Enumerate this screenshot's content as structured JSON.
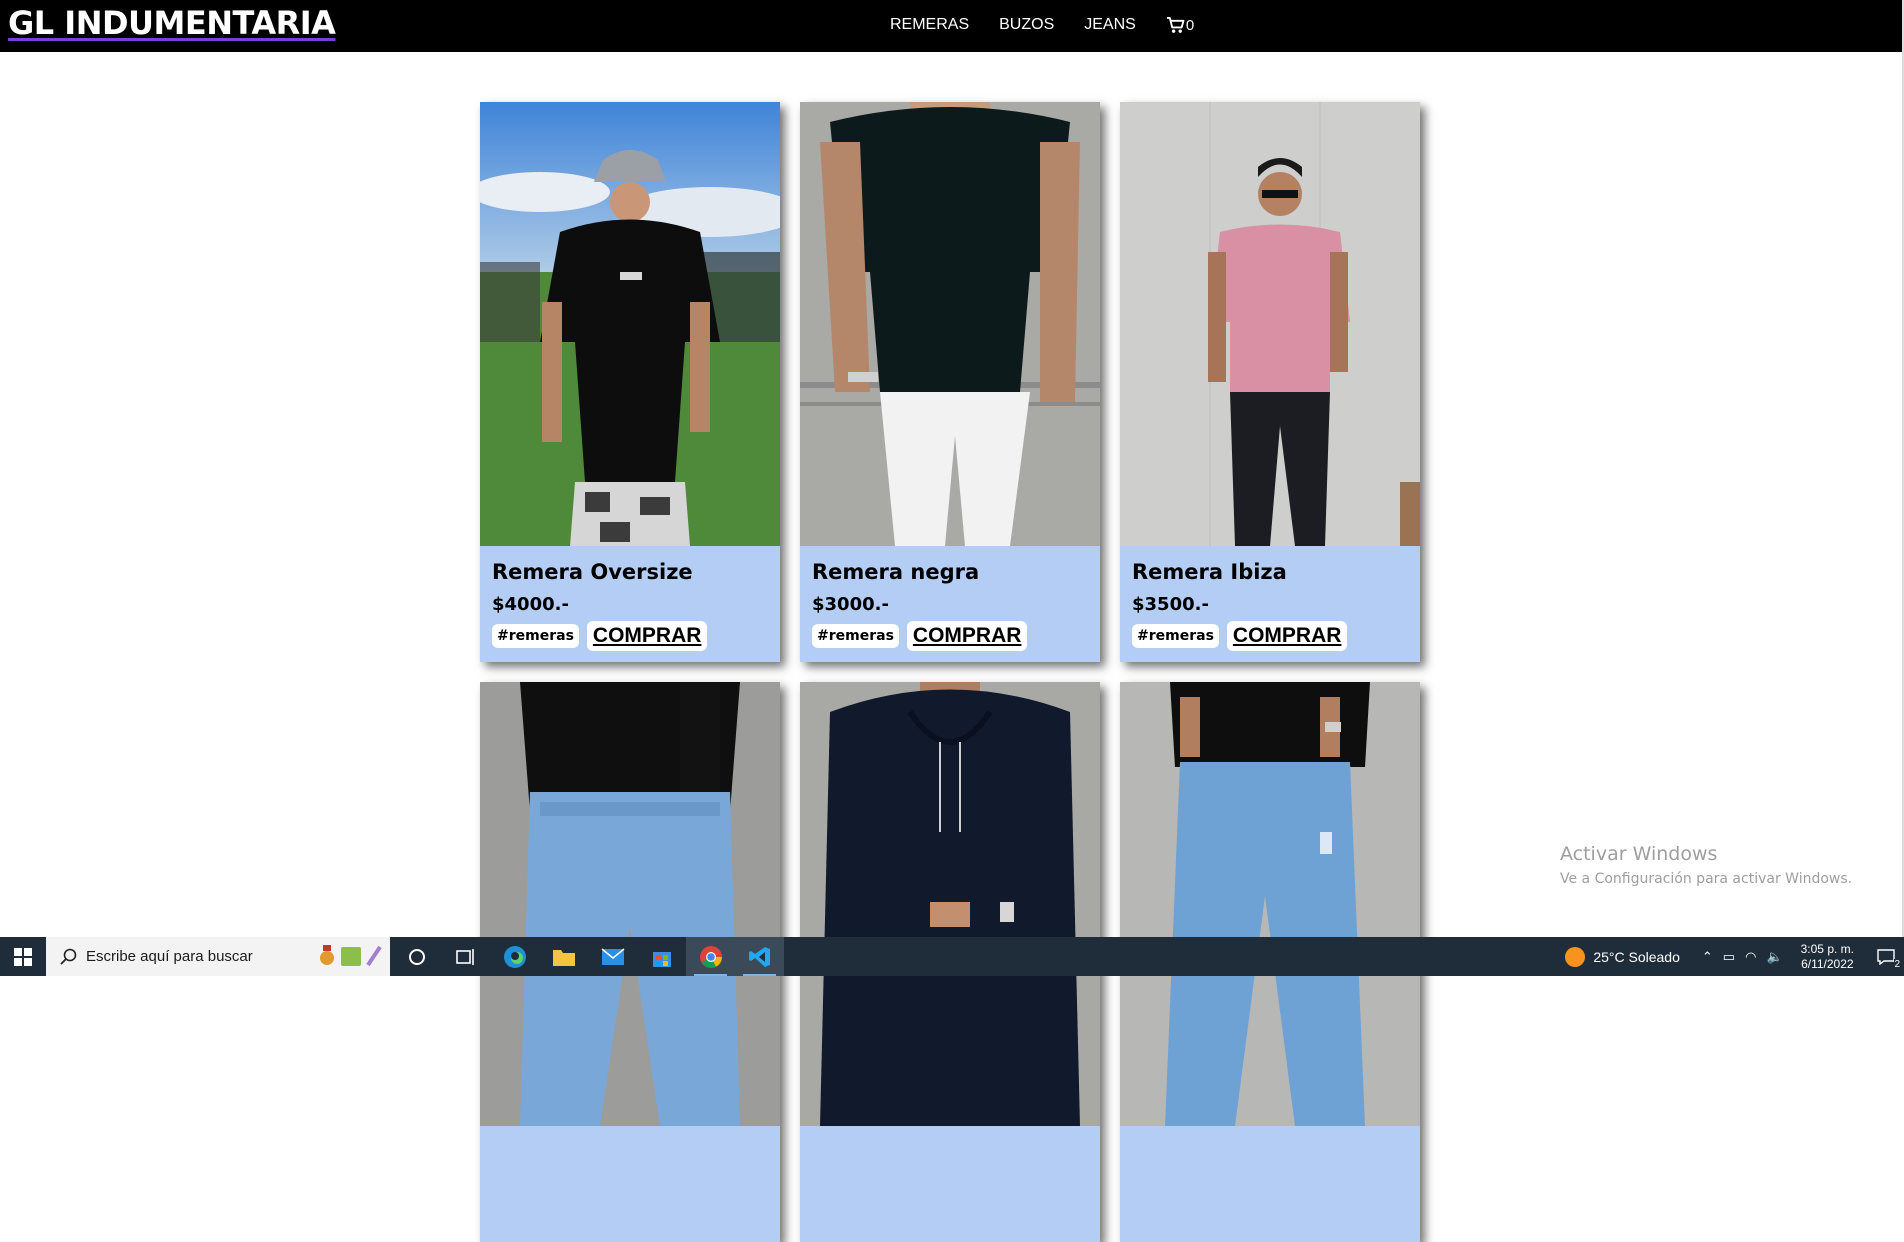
{
  "brand": "GL INDUMENTARIA",
  "nav": {
    "links": [
      "REMERAS",
      "BUZOS",
      "JEANS"
    ],
    "cart_count": "0"
  },
  "products": [
    {
      "title": "Remera Oversize",
      "price": "$4000.-",
      "tag": "#remeras",
      "buy_label": "COMPRAR"
    },
    {
      "title": "Remera negra",
      "price": "$3000.-",
      "tag": "#remeras",
      "buy_label": "COMPRAR"
    },
    {
      "title": "Remera Ibiza",
      "price": "$3500.-",
      "tag": "#remeras",
      "buy_label": "COMPRAR"
    },
    {
      "title": "",
      "price": "",
      "tag": "",
      "buy_label": ""
    },
    {
      "title": "",
      "price": "",
      "tag": "",
      "buy_label": ""
    },
    {
      "title": "",
      "price": "",
      "tag": "",
      "buy_label": ""
    }
  ],
  "watermark": {
    "line1": "Activar Windows",
    "line2": "Ve a Configuración para activar Windows."
  },
  "taskbar": {
    "search_placeholder": "Escribe aquí para buscar",
    "weather": "25°C  Soleado",
    "time": "3:05 p. m.",
    "date": "6/11/2022",
    "notification_count": "2"
  },
  "colors": {
    "card_bg": "#b3cdf5",
    "topbar_bg": "#000000",
    "brand_underline": "#7b3fd6",
    "taskbar_bg": "#1f2d3a"
  }
}
